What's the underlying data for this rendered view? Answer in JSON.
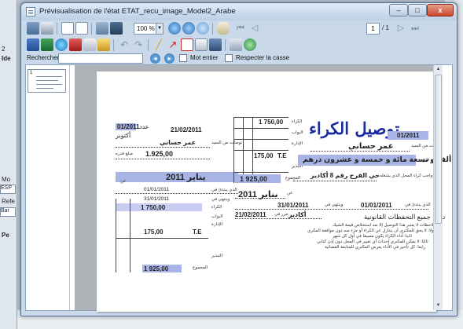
{
  "background": {
    "left_labels": [
      "2",
      "Ide"
    ],
    "left_fields": [
      "Mo",
      "ESP",
      "Refe",
      "Bar"
    ],
    "left_bottom_label": "Pe"
  },
  "window": {
    "title": "Prévisualisation de l'état ETAT_recu_image_Model2_Arabe",
    "min_label": "–",
    "max_label": "□",
    "close_label": "x"
  },
  "toolbar": {
    "zoom_value": "100 %",
    "page_current": "1",
    "page_count": "/ 1"
  },
  "search": {
    "label": "Rechercher :",
    "value": "",
    "whole_word_label": "Mot entier",
    "match_case_label": "Respecter la casse"
  },
  "thumbnail": {
    "page_number": "1"
  },
  "receipt": {
    "title": "توصيل الكراء",
    "number_label": "عدد",
    "number": "01/2011",
    "date": "21/02/2011",
    "date_label": "تاريخ",
    "month_text": "أكتوبر",
    "tenant_label": "توصلت من السيد",
    "tenant": "عمر حساني",
    "amount_label": "مبلغ قدره",
    "amount_words": "ألف و تسعة مائة و خمسة و عشرون درهم",
    "amount": "1 925,00",
    "amount_short": "1.925,00",
    "period_label": "عن",
    "period": "يناير 2011",
    "location_text": "وذلك واجب كراء المحل الذي يشغله",
    "address": "حي الفرح رقم 8 أكادير",
    "from_label": "الذي يبتدئ في",
    "from_date": "01/01/2011",
    "to_label": "وينتهي في",
    "to_date": "31/01/2011",
    "signed_label": "حرر في",
    "signed_place": "أكادير",
    "signed_date": "21/02/2011",
    "reserve": "تحت جميع التحفظات القانونية",
    "rent_label": "الكراء",
    "rent": "1 750,00",
    "door_label": "البواب",
    "admin_label": "الإدارة",
    "tax_label": "ض.ت",
    "tax": "175,00",
    "tax_code": "T.E",
    "other_label": "التبذير",
    "total_label": "المجموع",
    "stub_from_date": "01/01/2011",
    "stub_to_date": "31/01/2011",
    "stub_total": "1 925,00",
    "notes": [
      "ملاحظات لا يعتبر هذا التوصيل إلا بعد استخلاص قيمة الشيك",
      "أولا: لا يحق للمكتري أن يتنازل عن الكراء أو جزء منه دون موافقة المكري",
      "ثانيا: أداء الكراء يكون مسبقا في أول كل شهر",
      "ثالثا: لا يمكن للمكتري إحداث أي تغيير في المحل دون إذن كتابي",
      "رابعا: كل تأخير في الأداء يعرض المكتري للمتابعة القضائية"
    ]
  }
}
